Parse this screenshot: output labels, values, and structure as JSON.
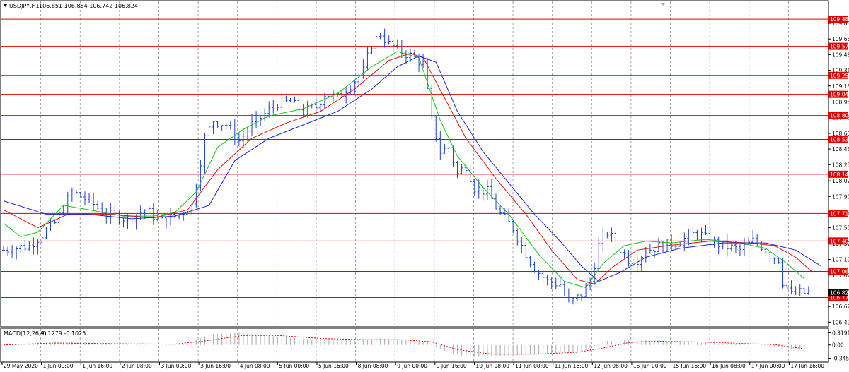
{
  "window": {
    "main_title": "USDJPY,H1",
    "main_ohlc": "106.851 106.864 106.742 106.824",
    "sub_title": "MACD(12,26,9)",
    "sub_values": "-0.1279 -0.1025"
  },
  "colors": {
    "candle": "#1f3fcf",
    "ma_fast": "#17c317",
    "ma_mid": "#e01010",
    "ma_slow": "#1b24d6",
    "hline": "#e00000",
    "hline_tag": "#e00000",
    "current_price_tag": "#000000",
    "macd_hist": "#b4b4b4",
    "macd_signal": "#e00000",
    "grid": "#8a8a8a"
  },
  "chart_data": [
    {
      "type": "candlestick",
      "title": "USDJPY,H1",
      "price_ticks": [
        109.835,
        109.66,
        109.485,
        109.31,
        109.135,
        108.955,
        108.78,
        108.605,
        108.43,
        108.255,
        108.075,
        107.9,
        107.725,
        107.55,
        107.375,
        107.195,
        107.02,
        106.845,
        106.67,
        106.495
      ],
      "ylim": [
        106.45,
        110.08
      ],
      "horizontal_levels": [
        109.882,
        109.578,
        109.253,
        109.041,
        108.805,
        108.537,
        108.148,
        107.71,
        107.402,
        107.062,
        106.77
      ],
      "current_price": 106.824,
      "time_labels": [
        "29 May 2020",
        "1 Jun 00:00",
        "1 Jun 16:00",
        "2 Jun 08:00",
        "3 Jun 00:00",
        "3 Jun 16:00",
        "4 Jun 08:00",
        "5 Jun 00:00",
        "5 Jun 16:00",
        "8 Jun 08:00",
        "9 Jun 00:00",
        "9 Jun 16:00",
        "10 Jun 08:00",
        "11 Jun 00:00",
        "11 Jun 16:00",
        "12 Jun 08:00",
        "15 Jun 00:00",
        "15 Jun 16:00",
        "16 Jun 08:00",
        "17 Jun 00:00",
        "17 Jun 16:00"
      ],
      "price_path": [
        [
          0,
          107.3
        ],
        [
          6,
          107.35
        ],
        [
          12,
          107.6
        ],
        [
          16,
          107.95
        ],
        [
          20,
          107.85
        ],
        [
          24,
          107.7
        ],
        [
          29,
          107.65
        ],
        [
          33,
          107.75
        ],
        [
          37,
          107.62
        ],
        [
          41,
          107.7
        ],
        [
          44,
          107.8
        ],
        [
          47,
          108.55
        ],
        [
          49,
          108.75
        ],
        [
          52,
          108.7
        ],
        [
          55,
          108.52
        ],
        [
          58,
          108.7
        ],
        [
          61,
          108.82
        ],
        [
          64,
          108.95
        ],
        [
          67,
          108.95
        ],
        [
          70,
          108.85
        ],
        [
          73,
          108.9
        ],
        [
          75,
          109.05
        ],
        [
          78,
          109.0
        ],
        [
          81,
          109.15
        ],
        [
          84,
          109.3
        ],
        [
          86,
          109.6
        ],
        [
          88,
          109.72
        ],
        [
          90,
          109.6
        ],
        [
          93,
          109.52
        ],
        [
          96,
          109.45
        ],
        [
          98,
          109.38
        ],
        [
          100,
          108.75
        ],
        [
          102,
          108.4
        ],
        [
          104,
          108.45
        ],
        [
          106,
          108.15
        ],
        [
          108,
          108.25
        ],
        [
          110,
          108.0
        ],
        [
          113,
          107.95
        ],
        [
          116,
          107.7
        ],
        [
          119,
          107.55
        ],
        [
          121,
          107.35
        ],
        [
          124,
          107.1
        ],
        [
          127,
          106.95
        ],
        [
          130,
          106.92
        ],
        [
          132,
          106.7
        ],
        [
          135,
          106.8
        ],
        [
          137,
          106.95
        ],
        [
          139,
          107.35
        ],
        [
          141,
          107.5
        ],
        [
          143,
          107.38
        ],
        [
          145,
          107.25
        ],
        [
          147,
          107.15
        ],
        [
          150,
          107.3
        ],
        [
          154,
          107.35
        ],
        [
          158,
          107.4
        ],
        [
          162,
          107.5
        ],
        [
          165,
          107.4
        ],
        [
          168,
          107.35
        ],
        [
          172,
          107.3
        ],
        [
          175,
          107.4
        ],
        [
          177,
          107.35
        ],
        [
          179,
          107.25
        ],
        [
          181,
          107.2
        ],
        [
          182,
          106.95
        ],
        [
          184,
          106.8
        ],
        [
          186,
          106.82
        ]
      ],
      "moving_averages": [
        {
          "name": "",
          "path": [
            [
              0,
              107.6
            ],
            [
              4,
              107.45
            ],
            [
              8,
              107.5
            ],
            [
              14,
              107.8
            ],
            [
              20,
              107.75
            ],
            [
              28,
              107.68
            ],
            [
              35,
              107.68
            ],
            [
              40,
              107.72
            ],
            [
              45,
              107.95
            ],
            [
              50,
              108.45
            ],
            [
              56,
              108.65
            ],
            [
              62,
              108.8
            ],
            [
              70,
              108.88
            ],
            [
              78,
              109.05
            ],
            [
              86,
              109.35
            ],
            [
              92,
              109.52
            ],
            [
              97,
              109.45
            ],
            [
              102,
              108.75
            ],
            [
              106,
              108.35
            ],
            [
              112,
              108.0
            ],
            [
              118,
              107.7
            ],
            [
              125,
              107.25
            ],
            [
              131,
              106.95
            ],
            [
              136,
              106.88
            ],
            [
              140,
              107.15
            ],
            [
              145,
              107.35
            ],
            [
              150,
              107.4
            ],
            [
              156,
              107.38
            ],
            [
              164,
              107.42
            ],
            [
              172,
              107.38
            ],
            [
              178,
              107.32
            ],
            [
              183,
              107.15
            ],
            [
              187,
              106.98
            ]
          ]
        },
        {
          "name": "",
          "path": [
            [
              0,
              107.75
            ],
            [
              8,
              107.55
            ],
            [
              15,
              107.7
            ],
            [
              25,
              107.7
            ],
            [
              35,
              107.66
            ],
            [
              43,
              107.75
            ],
            [
              50,
              108.2
            ],
            [
              58,
              108.55
            ],
            [
              66,
              108.72
            ],
            [
              74,
              108.85
            ],
            [
              82,
              109.1
            ],
            [
              90,
              109.42
            ],
            [
              95,
              109.5
            ],
            [
              98,
              109.45
            ],
            [
              103,
              109.0
            ],
            [
              108,
              108.55
            ],
            [
              115,
              108.1
            ],
            [
              122,
              107.7
            ],
            [
              128,
              107.3
            ],
            [
              134,
              106.97
            ],
            [
              138,
              106.92
            ],
            [
              142,
              107.1
            ],
            [
              148,
              107.3
            ],
            [
              155,
              107.35
            ],
            [
              165,
              107.4
            ],
            [
              174,
              107.38
            ],
            [
              180,
              107.35
            ],
            [
              185,
              107.22
            ],
            [
              189,
              107.05
            ]
          ]
        },
        {
          "name": "",
          "path": [
            [
              0,
              107.85
            ],
            [
              10,
              107.7
            ],
            [
              20,
              107.7
            ],
            [
              30,
              107.65
            ],
            [
              40,
              107.68
            ],
            [
              48,
              107.8
            ],
            [
              54,
              108.3
            ],
            [
              62,
              108.55
            ],
            [
              70,
              108.7
            ],
            [
              78,
              108.85
            ],
            [
              86,
              109.1
            ],
            [
              92,
              109.35
            ],
            [
              97,
              109.47
            ],
            [
              101,
              109.4
            ],
            [
              106,
              108.85
            ],
            [
              112,
              108.4
            ],
            [
              118,
              108.05
            ],
            [
              124,
              107.7
            ],
            [
              130,
              107.4
            ],
            [
              135,
              107.12
            ],
            [
              139,
              106.95
            ],
            [
              144,
              107.05
            ],
            [
              150,
              107.22
            ],
            [
              158,
              107.32
            ],
            [
              168,
              107.38
            ],
            [
              178,
              107.38
            ],
            [
              185,
              107.3
            ],
            [
              191,
              107.12
            ]
          ]
        }
      ]
    },
    {
      "type": "macd",
      "title": "MACD(12,26,9)",
      "values": [
        -0.1279,
        -0.1025
      ],
      "ticks": [
        0.3191,
        0.0,
        -0.3459
      ],
      "ylim": [
        -0.43,
        0.42
      ],
      "histogram_path": [
        [
          0,
          0.0
        ],
        [
          10,
          0.06
        ],
        [
          20,
          0.08
        ],
        [
          28,
          0.01
        ],
        [
          36,
          0.0
        ],
        [
          43,
          0.02
        ],
        [
          48,
          0.28
        ],
        [
          55,
          0.32
        ],
        [
          62,
          0.24
        ],
        [
          70,
          0.15
        ],
        [
          80,
          0.12
        ],
        [
          88,
          0.17
        ],
        [
          95,
          0.12
        ],
        [
          99,
          0.08
        ],
        [
          103,
          -0.15
        ],
        [
          108,
          -0.32
        ],
        [
          115,
          -0.3
        ],
        [
          122,
          -0.25
        ],
        [
          130,
          -0.2
        ],
        [
          136,
          -0.15
        ],
        [
          140,
          0.1
        ],
        [
          145,
          0.12
        ],
        [
          150,
          0.12
        ],
        [
          158,
          0.08
        ],
        [
          168,
          0.03
        ],
        [
          176,
          0.0
        ],
        [
          182,
          -0.07
        ],
        [
          187,
          -0.13
        ]
      ],
      "signal_path": [
        [
          0,
          0.0
        ],
        [
          12,
          0.05
        ],
        [
          28,
          0.03
        ],
        [
          40,
          0.02
        ],
        [
          48,
          0.12
        ],
        [
          56,
          0.25
        ],
        [
          64,
          0.25
        ],
        [
          74,
          0.17
        ],
        [
          84,
          0.14
        ],
        [
          93,
          0.14
        ],
        [
          100,
          0.08
        ],
        [
          106,
          -0.12
        ],
        [
          114,
          -0.24
        ],
        [
          124,
          -0.24
        ],
        [
          134,
          -0.19
        ],
        [
          140,
          -0.08
        ],
        [
          146,
          0.06
        ],
        [
          152,
          0.1
        ],
        [
          162,
          0.08
        ],
        [
          172,
          0.04
        ],
        [
          180,
          0.01
        ],
        [
          187,
          -0.1
        ]
      ]
    }
  ]
}
